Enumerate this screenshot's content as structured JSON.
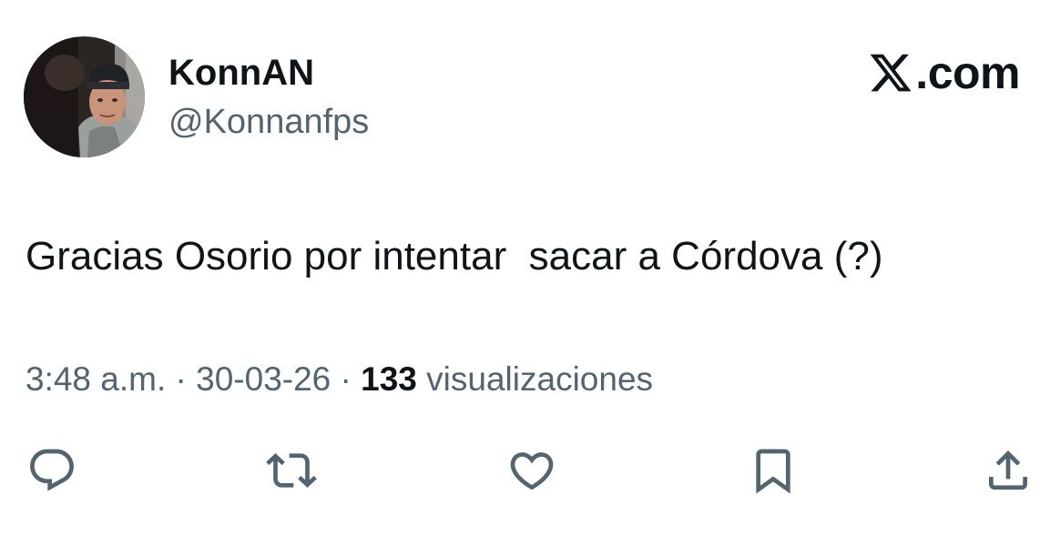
{
  "tweet": {
    "author": {
      "display_name": "KonnAN",
      "handle": "@Konnanfps"
    },
    "brand": {
      "label": ".com",
      "icon": "x-logo-icon"
    },
    "text": "Gracias Osorio por intentar  sacar a Córdova (?)",
    "meta": {
      "time": "3:48 a.m.",
      "separator": " · ",
      "date": "30-03-26",
      "views_count": "133",
      "views_label": "visualizaciones"
    },
    "actions": [
      {
        "name": "reply",
        "icon": "speech-bubble-icon"
      },
      {
        "name": "retweet",
        "icon": "retweet-arrows-icon"
      },
      {
        "name": "like",
        "icon": "heart-icon"
      },
      {
        "name": "bookmark",
        "icon": "bookmark-icon"
      },
      {
        "name": "share",
        "icon": "share-upload-icon"
      }
    ]
  },
  "colors": {
    "text_primary": "#0f1419",
    "text_secondary": "#536471",
    "background": "#ffffff"
  }
}
